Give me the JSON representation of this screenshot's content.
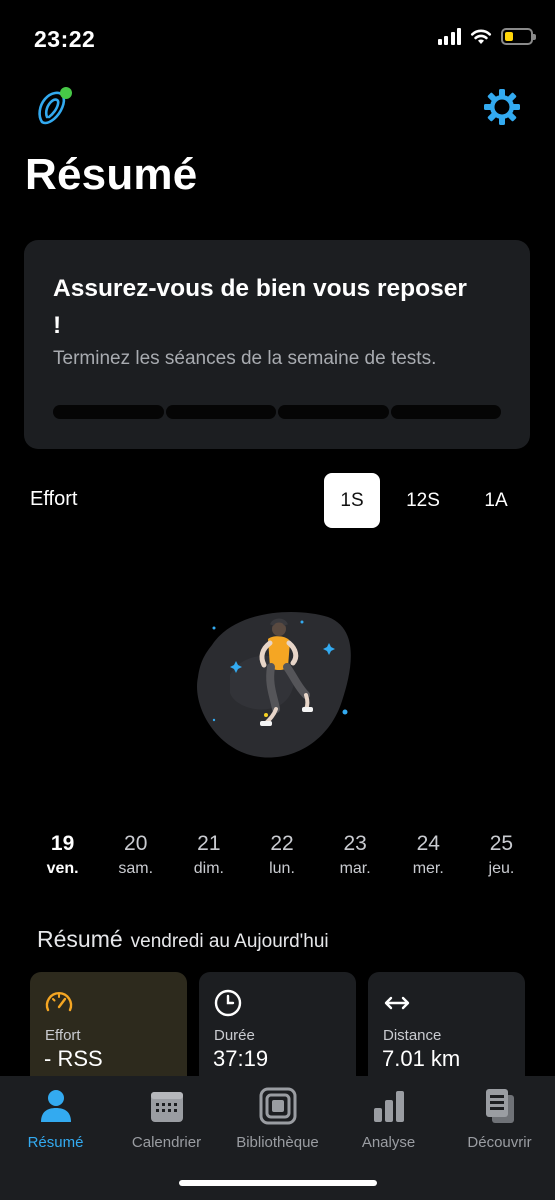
{
  "status": {
    "time": "23:22"
  },
  "header": {
    "title": "Résumé"
  },
  "card": {
    "title": "Assurez-vous de bien vous reposer !",
    "subtitle": "Terminez les séances de la semaine de tests.",
    "progress_segments": 4,
    "progress_completed": 0
  },
  "effort": {
    "label": "Effort",
    "ranges": [
      "1S",
      "12S",
      "1A"
    ],
    "selected": "1S"
  },
  "days": [
    {
      "num": "19",
      "name": "ven.",
      "selected": true
    },
    {
      "num": "20",
      "name": "sam.",
      "selected": false
    },
    {
      "num": "21",
      "name": "dim.",
      "selected": false
    },
    {
      "num": "22",
      "name": "lun.",
      "selected": false
    },
    {
      "num": "23",
      "name": "mar.",
      "selected": false
    },
    {
      "num": "24",
      "name": "mer.",
      "selected": false
    },
    {
      "num": "25",
      "name": "jeu.",
      "selected": false
    }
  ],
  "summary": {
    "title": "Résumé",
    "range": "vendredi au Aujourd'hui",
    "metrics": [
      {
        "icon": "gauge-icon",
        "label": "Effort",
        "value": "- RSS"
      },
      {
        "icon": "clock-icon",
        "label": "Durée",
        "value": "37:19"
      },
      {
        "icon": "arrows-horizontal-icon",
        "label": "Distance",
        "value": "7.01 km"
      }
    ]
  },
  "tabs": [
    {
      "label": "Résumé",
      "icon": "person-icon",
      "active": true
    },
    {
      "label": "Calendrier",
      "icon": "calendar-icon",
      "active": false
    },
    {
      "label": "Bibliothèque",
      "icon": "library-icon",
      "active": false
    },
    {
      "label": "Analyse",
      "icon": "bar-chart-icon",
      "active": false
    },
    {
      "label": "Découvrir",
      "icon": "articles-icon",
      "active": false
    }
  ],
  "colors": {
    "accent": "#33aaf0",
    "effort_highlight": "#f5a623",
    "background": "#000000",
    "card": "#1c1e21"
  }
}
